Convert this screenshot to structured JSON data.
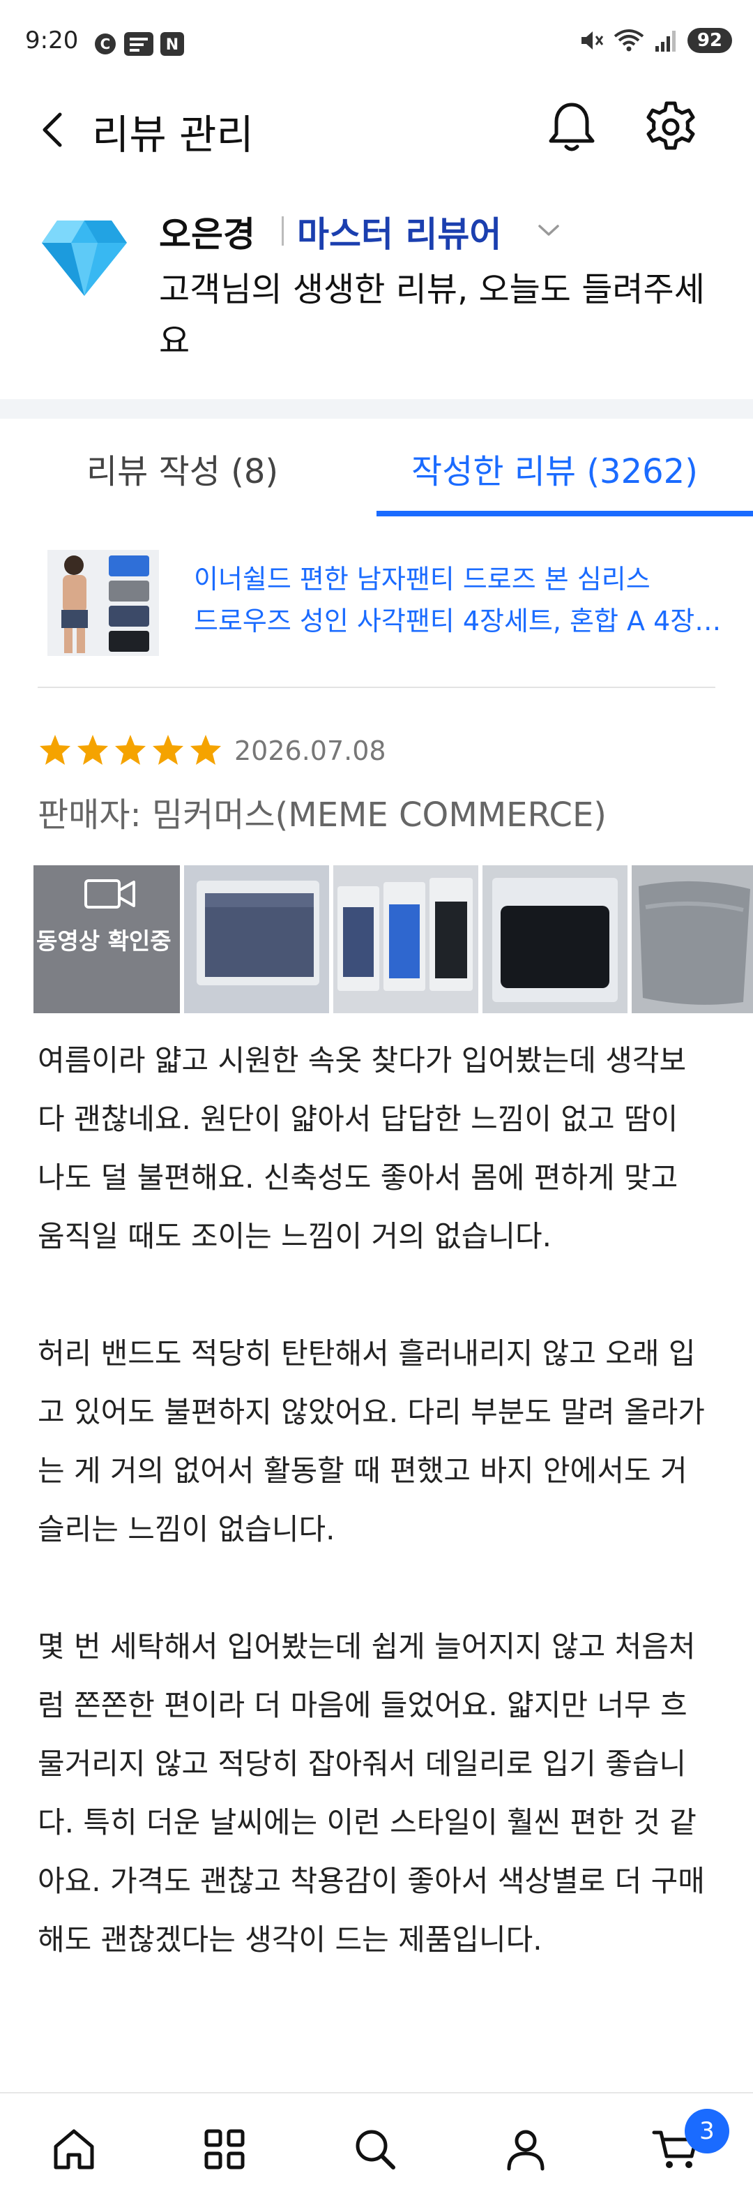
{
  "status_bar": {
    "time": "9:20",
    "battery": "92"
  },
  "header": {
    "title": "리뷰 관리"
  },
  "profile": {
    "name": "오은경",
    "level": "마스터 리뷰어",
    "message": "고객님의 생생한 리뷰, 오늘도 들려주세요"
  },
  "tabs": [
    {
      "label": "리뷰 작성 (8)",
      "active": false
    },
    {
      "label": "작성한 리뷰 (3262)",
      "active": true
    }
  ],
  "product": {
    "title_line1": "이너쉴드 편한 남자팬티 드로즈 본 심리스",
    "title_line2": "드로우즈 성인 사각팬티 4장세트, 혼합 A 4장…"
  },
  "review": {
    "rating": 5,
    "date": "2026.07.08",
    "seller": "판매자: 밈커머스(MEME COMMERCE)",
    "video_label": "동영상 확인중",
    "paragraphs": [
      "여름이라 얇고 시원한 속옷 찾다가 입어봤는데 생각보다 괜찮네요. 원단이 얇아서 답답한 느낌이 없고 땀이 나도 덜 불편해요. 신축성도 좋아서 몸에 편하게 맞고 움직일 때도 조이는 느낌이 거의 없습니다.",
      "허리 밴드도 적당히 탄탄해서 흘러내리지 않고 오래 입고 있어도 불편하지 않았어요. 다리 부분도 말려 올라가는 게 거의 없어서 활동할 때 편했고 바지 안에서도 거슬리는 느낌이 없습니다.",
      "몇 번 세탁해서 입어봤는데 쉽게 늘어지지 않고 처음처럼 쫀쫀한 편이라 더 마음에 들었어요. 얇지만 너무 흐물거리지 않고 적당히 잡아줘서 데일리로 입기 좋습니다. 특히 더운 날씨에는 이런 스타일이 훨씬 편한 것 같아요. 가격도 괜찮고 착용감이 좋아서 색상별로 더 구매해도 괜찮겠다는 생각이 드는 제품입니다."
    ]
  },
  "bottom_nav": {
    "cart_badge": "3"
  },
  "colors": {
    "accent": "#1a6bff",
    "level": "#1b3faf",
    "star": "#f5a300"
  }
}
